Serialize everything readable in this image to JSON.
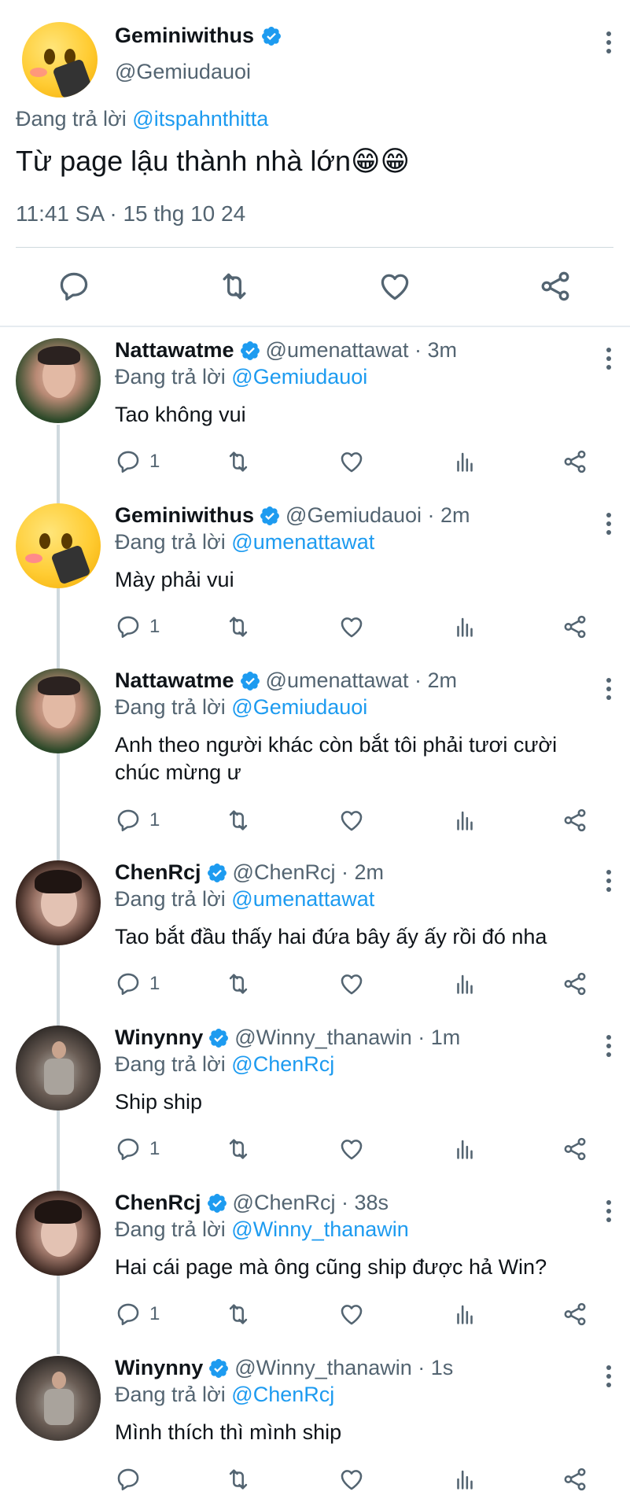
{
  "main_tweet": {
    "name": "Geminiwithus",
    "handle": "@Gemiudauoi",
    "replying_prefix": "Đang trả lời",
    "replying_to": "@itspahnthitta",
    "text": "Từ page lậu thành nhà lớn😁😁",
    "timestamp": "11:41 SA · 15 thg 10 24"
  },
  "colors": {
    "accent": "#1d9bf0",
    "secondary_text": "#536471",
    "primary_text": "#0f1419",
    "divider": "#cfd9de"
  },
  "replies": [
    {
      "name": "Nattawatme",
      "meta": "@umenattawat · 3m",
      "replying_prefix": "Đang trả lời",
      "replying_to": "@Gemiudauoi",
      "text": "Tao không vui",
      "reply_count": "1"
    },
    {
      "name": "Geminiwithus",
      "meta": "@Gemiudauoi · 2m",
      "replying_prefix": "Đang trả lời",
      "replying_to": "@umenattawat",
      "text": "Mày phải vui",
      "reply_count": "1"
    },
    {
      "name": "Nattawatme",
      "meta": "@umenattawat · 2m",
      "replying_prefix": "Đang trả lời",
      "replying_to": "@Gemiudauoi",
      "text": "Anh theo người khác còn bắt tôi phải tươi cười chúc mừng ư",
      "reply_count": "1"
    },
    {
      "name": "ChenRcj",
      "meta": "@ChenRcj · 2m",
      "replying_prefix": "Đang trả lời",
      "replying_to": "@umenattawat",
      "text": "Tao bắt đầu thấy hai đứa bây ấy ấy rồi đó nha",
      "reply_count": "1"
    },
    {
      "name": "Winynny",
      "meta": "@Winny_thanawin · 1m",
      "replying_prefix": "Đang trả lời",
      "replying_to": "@ChenRcj",
      "text": "Ship ship",
      "reply_count": "1"
    },
    {
      "name": "ChenRcj",
      "meta": "@ChenRcj · 38s",
      "replying_prefix": "Đang trả lời",
      "replying_to": "@Winny_thanawin",
      "text": "Hai cái page mà ông cũng ship được hả Win?",
      "reply_count": "1"
    },
    {
      "name": "Winynny",
      "meta": "@Winny_thanawin · 1s",
      "replying_prefix": "Đang trả lời",
      "replying_to": "@ChenRcj",
      "text": "Mình thích thì mình ship",
      "reply_count": ""
    }
  ],
  "icons": {
    "reply": "reply-icon",
    "retweet": "retweet-icon",
    "like": "like-icon",
    "views": "views-icon",
    "share": "share-icon",
    "verified": "verified-badge-icon",
    "more": "more-options-icon"
  }
}
